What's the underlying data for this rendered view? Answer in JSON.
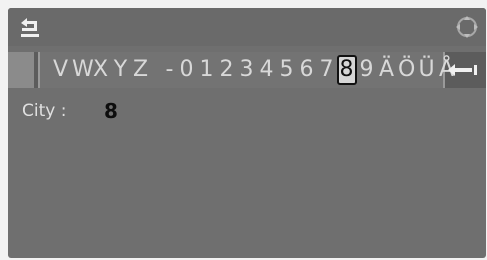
{
  "header": {
    "back_icon": "back-arrow-icon",
    "controller_icon": "controller-knob-icon"
  },
  "speller": {
    "characters": [
      "V",
      "W",
      "X",
      "Y",
      "Z",
      " ",
      "-",
      "0",
      "1",
      "2",
      "3",
      "4",
      "5",
      "6",
      "7",
      "8",
      "9",
      "Ä",
      "Ö",
      "Ü",
      "Å"
    ],
    "selected_character": "8",
    "enter_icon": "enter-arrow-icon"
  },
  "field": {
    "label": "City :",
    "value": "8"
  },
  "colors": {
    "screen_bg": "#6f6f6f",
    "highlight_bg": "#d6d6d6"
  }
}
